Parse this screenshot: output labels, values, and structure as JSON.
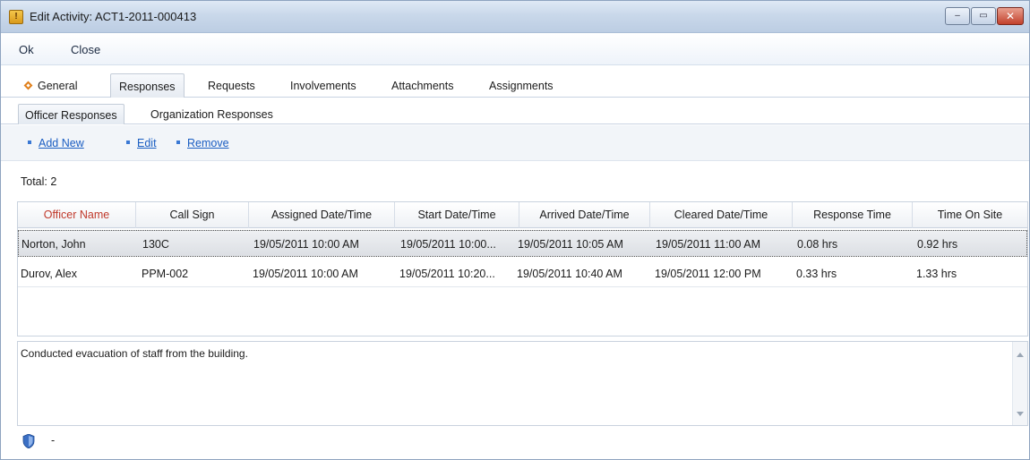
{
  "window": {
    "title": "Edit Activity: ACT1-2011-000413",
    "app_icon_glyph": "!",
    "minimize_glyph": "–",
    "maximize_glyph": "▭",
    "close_glyph": "✕"
  },
  "menu": {
    "ok_label": "Ok",
    "close_label": "Close"
  },
  "main_tabs": [
    {
      "label": "General",
      "icon": "diamond-icon"
    },
    {
      "label": "Responses",
      "active": true
    },
    {
      "label": "Requests"
    },
    {
      "label": "Involvements"
    },
    {
      "label": "Attachments"
    },
    {
      "label": "Assignments"
    }
  ],
  "sub_tabs": [
    {
      "label": "Officer Responses",
      "active": true
    },
    {
      "label": "Organization Responses"
    }
  ],
  "toolbar": {
    "add_new_label": "Add New",
    "edit_label": "Edit",
    "remove_label": "Remove"
  },
  "total": {
    "text": "Total: 2"
  },
  "grid": {
    "headers": [
      "Officer Name",
      "Call Sign",
      "Assigned Date/Time",
      "Start Date/Time",
      "Arrived Date/Time",
      "Cleared Date/Time",
      "Response Time",
      "Time On Site"
    ],
    "sorted_column": "Officer Name",
    "rows": [
      {
        "officer_name": "Norton, John",
        "call_sign": "130C",
        "assigned": "19/05/2011  10:00 AM",
        "start": "19/05/2011   10:00...",
        "arrived": "19/05/2011  10:05 AM",
        "cleared": "19/05/2011  11:00 AM",
        "response_time": "0.08 hrs",
        "time_on_site": "0.92 hrs",
        "selected": true
      },
      {
        "officer_name": "Durov, Alex",
        "call_sign": "PPM-002",
        "assigned": "19/05/2011  10:00 AM",
        "start": "19/05/2011   10:20...",
        "arrived": "19/05/2011  10:40 AM",
        "cleared": "19/05/2011  12:00 PM",
        "response_time": "0.33 hrs",
        "time_on_site": "1.33 hrs"
      }
    ]
  },
  "notes": {
    "text": "Conducted evacuation of staff from the building."
  },
  "status": {
    "text": "-"
  },
  "colors": {
    "accent": "#1a5dc2",
    "sorted_header": "#c0392b",
    "tab_diamond": "#e07f1a"
  }
}
